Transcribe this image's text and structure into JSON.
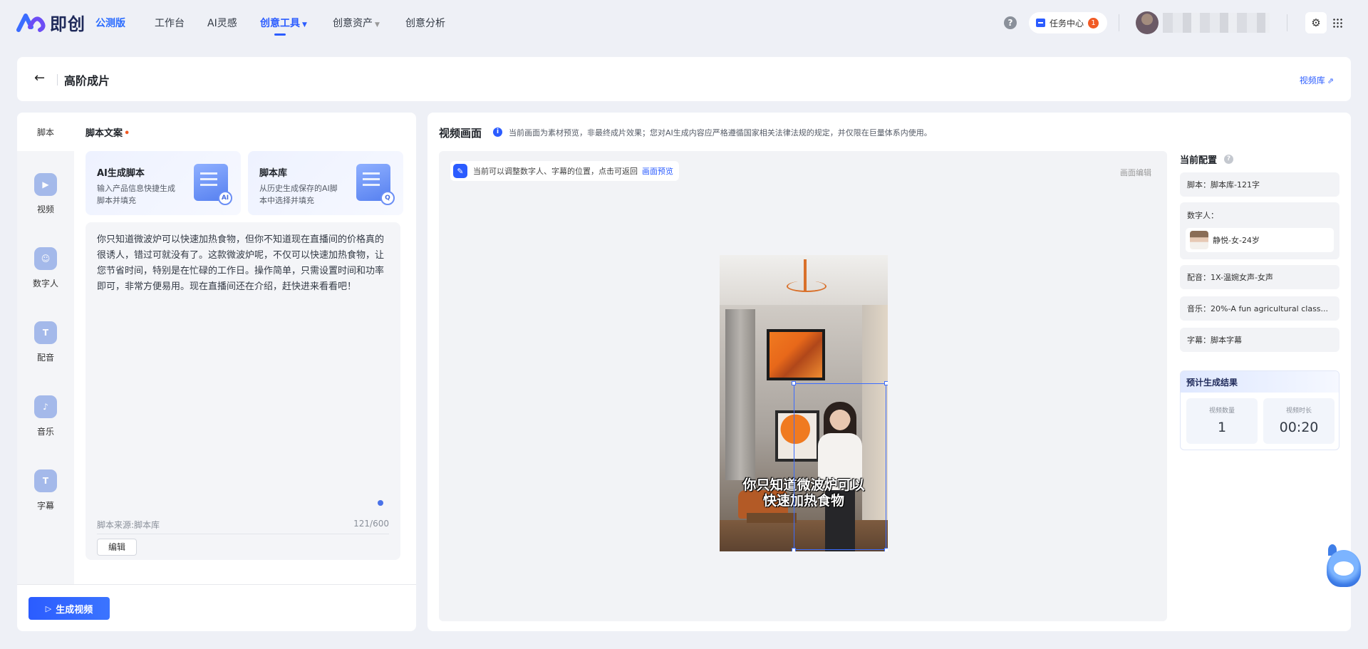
{
  "brand": {
    "logo_text": "即创",
    "edition": "公测版",
    "accent": "#2b5cff"
  },
  "nav": {
    "items": [
      {
        "label": "工作台"
      },
      {
        "label": "AI灵感"
      },
      {
        "label": "创意工具"
      },
      {
        "label": "创意资产"
      },
      {
        "label": "创意分析"
      }
    ],
    "active": "创意工具"
  },
  "topbar": {
    "help": "?",
    "task_center": "任务中心",
    "task_count": "1"
  },
  "header": {
    "title": "高阶成片",
    "video_library": "视频库"
  },
  "left_tabs": [
    "脚本",
    "视频",
    "数字人",
    "配音",
    "音乐",
    "字幕"
  ],
  "script": {
    "section_label": "脚本文案",
    "required_mark": "•",
    "options": [
      {
        "title": "AI生成脚本",
        "desc": "输入产品信息快捷生成脚本并填充",
        "badge": "AI"
      },
      {
        "title": "脚本库",
        "desc": "从历史生成保存的AI脚本中选择并填充",
        "badge": "Q"
      }
    ],
    "content": "你只知道微波炉可以快速加热食物，但你不知道现在直播间的价格真的很诱人，错过可就没有了。这款微波炉呢，不仅可以快速加热食物，让您节省时间，特别是在忙碌的工作日。操作简单，只需设置时间和功率即可，非常方便易用。现在直播间还在介绍，赶快进来看看吧！",
    "source": "脚本来源:脚本库",
    "count": "121/600",
    "edit_label": "编辑"
  },
  "generate_button": "生成视频",
  "canvas": {
    "title": "视频画面",
    "note": "当前画面为素材预览，非最终成片效果；您对AI生成内容应严格遵循国家相关法律法规的规定，并仅限在巨量体系内使用。",
    "hint": "当前可以调整数字人、字幕的位置，点击可返回",
    "hint_link": "画面预览",
    "edit_link": "画面编辑",
    "subtitle_line1": "你只知道微波炉可以",
    "subtitle_line2": "快速加热食物"
  },
  "config": {
    "title": "当前配置",
    "script": "脚本：脚本库-121字",
    "digital_human_label": "数字人：",
    "digital_human": "静悦-女-24岁",
    "voice": "配音：1X-温婉女声-女声",
    "music": "音乐：20%-A fun agricultural class...",
    "subtitle": "字幕：脚本字幕"
  },
  "result": {
    "title": "预计生成结果",
    "count_label": "视频数量",
    "count_value": "1",
    "duration_label": "视频时长",
    "duration_value": "00:20"
  }
}
